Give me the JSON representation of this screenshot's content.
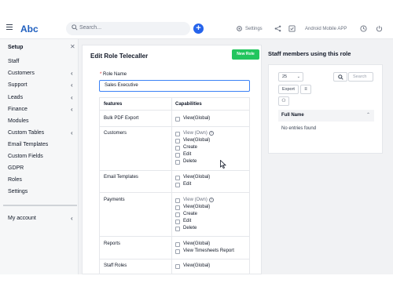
{
  "header": {
    "logo": "Abc",
    "search_placeholder": "Search...",
    "settings_label": "Settings",
    "app_label": "Android Mobile APP",
    "accent_color": "#2563eb",
    "icons": [
      "menu-icon",
      "search-icon",
      "plus-icon",
      "gear-icon",
      "share-icon",
      "checkbox-icon",
      "clock-icon",
      "power-icon"
    ]
  },
  "sidebar": {
    "title": "Setup",
    "items": [
      {
        "label": "Staff"
      },
      {
        "label": "Customers"
      },
      {
        "label": "Support"
      },
      {
        "label": "Leads"
      },
      {
        "label": "Finance"
      },
      {
        "label": "Modules"
      },
      {
        "label": "Custom Tables"
      },
      {
        "label": "Email Templates"
      },
      {
        "label": "Custom Fields"
      },
      {
        "label": "GDPR"
      },
      {
        "label": "Roles"
      },
      {
        "label": "Settings"
      }
    ],
    "account": "My account"
  },
  "role_form": {
    "title": "Edit Role Telecaller",
    "new_role_label": "New Role",
    "new_role_color": "#22c55e",
    "role_name_label": "Role Name",
    "role_name_value": "Sales Executive",
    "col_features": "features",
    "col_capabilities": "Capabilities",
    "rows": [
      {
        "feature": "Bulk PDF Export",
        "caps": [
          "View(Global)"
        ]
      },
      {
        "feature": "Customers",
        "caps": [
          "View (Own)",
          "View(Global)",
          "Create",
          "Edit",
          "Delete"
        ]
      },
      {
        "feature": "Email Templates",
        "caps": [
          "View(Global)",
          "Edit"
        ]
      },
      {
        "feature": "Payments",
        "caps": [
          "View (Own)",
          "View(Global)",
          "Create",
          "Edit",
          "Delete"
        ]
      },
      {
        "feature": "Reports",
        "caps": [
          "View(Global)",
          "View Timesheets Report"
        ]
      },
      {
        "feature": "Staff Roles",
        "caps": [
          "View(Global)"
        ]
      }
    ]
  },
  "staff_panel": {
    "title": "Staff members using this role",
    "page_size": "25",
    "search_placeholder": "Search",
    "export_label": "Export",
    "column": "Full Name",
    "empty": "No entries found"
  }
}
